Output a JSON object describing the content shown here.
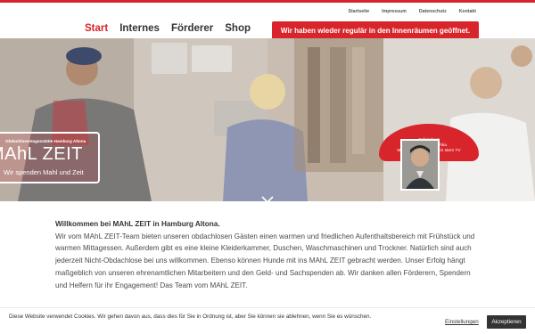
{
  "utility_nav": [
    "Startseite",
    "Impressum",
    "Datenschutz",
    "Kontakt"
  ],
  "main_nav": [
    {
      "label": "Start",
      "active": true
    },
    {
      "label": "Internes",
      "active": false
    },
    {
      "label": "Förderer",
      "active": false
    },
    {
      "label": "Shop",
      "active": false
    }
  ],
  "notice": "Wir haben wieder regulär in den Innenräumen geöffnet.",
  "hero": {
    "logo_small": "Obdachlosentagesstätte Hamburg Altona",
    "logo_big": "MAhL ZEIT",
    "logo_sub": "Wir spenden Mahl und Zeit",
    "badge_lines": [
      "Schirmherr",
      "Steffen Hallaschka",
      "Moderator RTL-Magazin stern TV"
    ]
  },
  "content": {
    "heading": "Willkommen bei MAhL ZEIT in Hamburg Altona.",
    "body": "Wir vom MAhL ZEIT-Team bieten unseren obdachlosen Gästen einen warmen und friedlichen Aufenthaltsbereich mit Frühstück und warmen Mittagessen. Außerdem gibt es eine kleine Kleiderkammer, Duschen, Waschmaschinen und Trockner. Natürlich sind auch jederzeit Nicht-Obdachlose bei uns willkommen. Ebenso können Hunde mit ins MAhL ZEIT gebracht werden. Unser Erfolg hängt maßgeblich von unseren ehrenamtlichen Mitarbeitern und den Geld- und Sachspenden ab. Wir danken allen Förderern, Spendern und Helfern für ihr Engagement! Das Team vom MAhL ZEIT."
  },
  "cookie": {
    "text": "Diese Website verwendet Cookies. Wir gehen davon aus, dass dies für Sie in Ordnung ist, aber Sie können sie ablehnen, wenn Sie es wünschen.",
    "settings_label": "Einstellungen",
    "accept_label": "Akzeptieren"
  },
  "colors": {
    "accent": "#d8252b",
    "text": "#444444",
    "button": "#333333"
  }
}
